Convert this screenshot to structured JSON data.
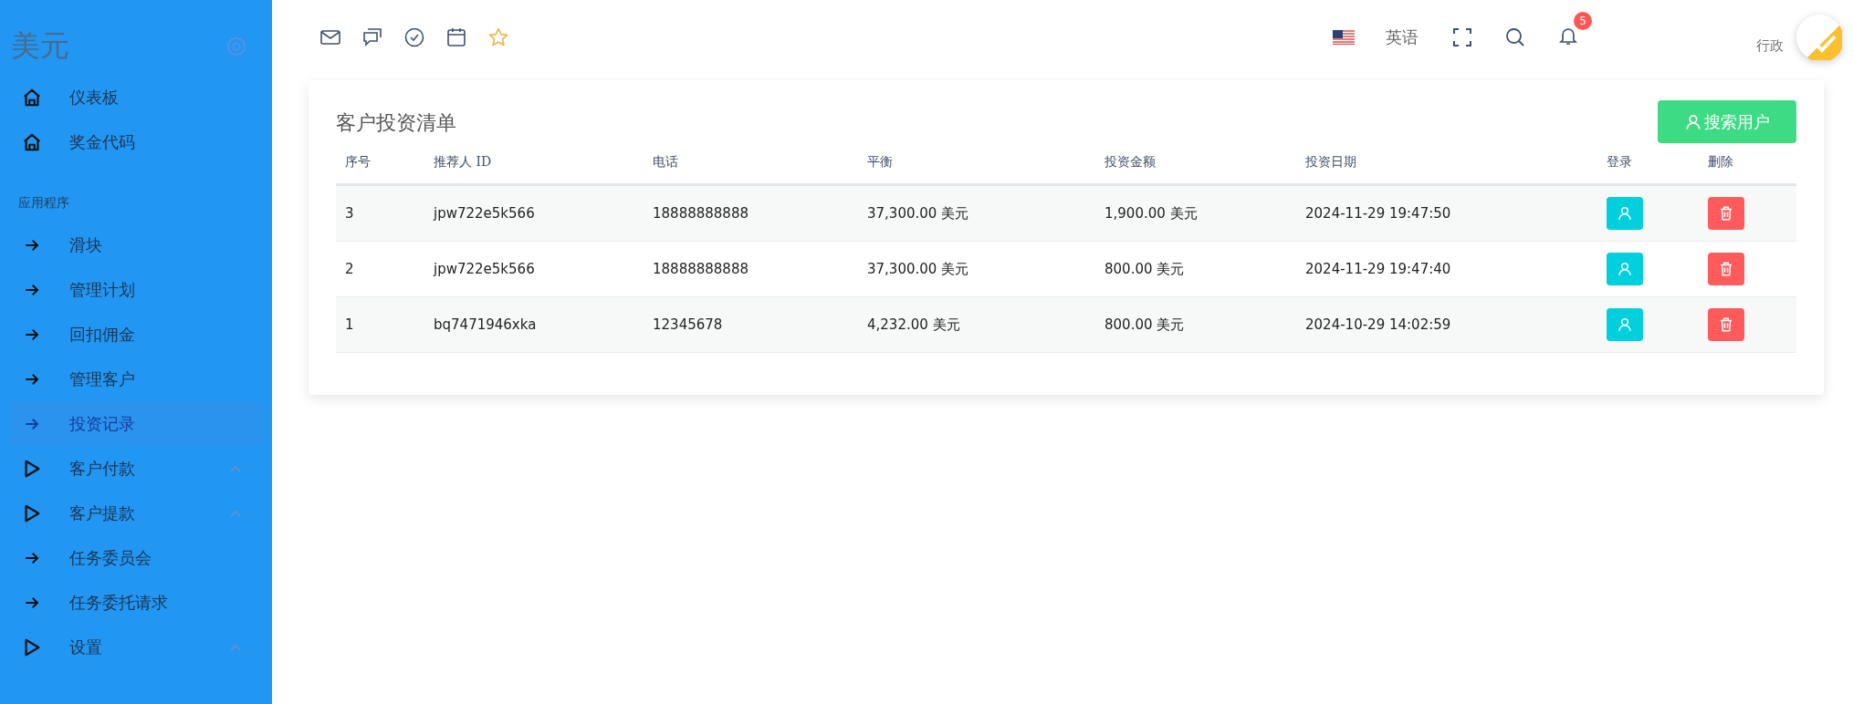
{
  "sidebar": {
    "logo": "美元",
    "items": [
      {
        "kind": "home",
        "label": "仪表板",
        "selected": false
      },
      {
        "kind": "home",
        "label": "奖金代码",
        "selected": false
      }
    ],
    "section": "应用程序",
    "app_items": [
      {
        "kind": "page",
        "label": "滑块",
        "selected": false
      },
      {
        "kind": "page",
        "label": "管理计划",
        "selected": false
      },
      {
        "kind": "page",
        "label": "回扣佣金",
        "selected": false
      },
      {
        "kind": "page",
        "label": "管理客户",
        "selected": false
      },
      {
        "kind": "page",
        "label": "投资记录",
        "selected": true
      },
      {
        "kind": "group",
        "label": "客户付款",
        "selected": false
      },
      {
        "kind": "group",
        "label": "客户提款",
        "selected": false
      },
      {
        "kind": "page",
        "label": "任务委员会",
        "selected": false
      },
      {
        "kind": "page",
        "label": "任务委托请求",
        "selected": false
      },
      {
        "kind": "group",
        "label": "设置",
        "selected": false
      }
    ]
  },
  "topbar": {
    "language": "英语",
    "notifications": "5",
    "user": "行政"
  },
  "card": {
    "title": "客户投资清单",
    "search_button": "搜索用户",
    "columns": [
      "序号",
      "推荐人 ID",
      "电话",
      "平衡",
      "投资金额",
      "投资日期",
      "登录",
      "删除"
    ],
    "rows": [
      [
        "3",
        "jpw722e5k566",
        "18888888888",
        "37,300.00 美元",
        "1,900.00 美元",
        "2024-11-29 19:47:50"
      ],
      [
        "2",
        "jpw722e5k566",
        "18888888888",
        "37,300.00 美元",
        "800.00 美元",
        "2024-11-29 19:47:40"
      ],
      [
        "1",
        "bq7471946xka",
        "12345678",
        "4,232.00 美元",
        "800.00 美元",
        "2024-10-29 14:02:59"
      ]
    ]
  }
}
